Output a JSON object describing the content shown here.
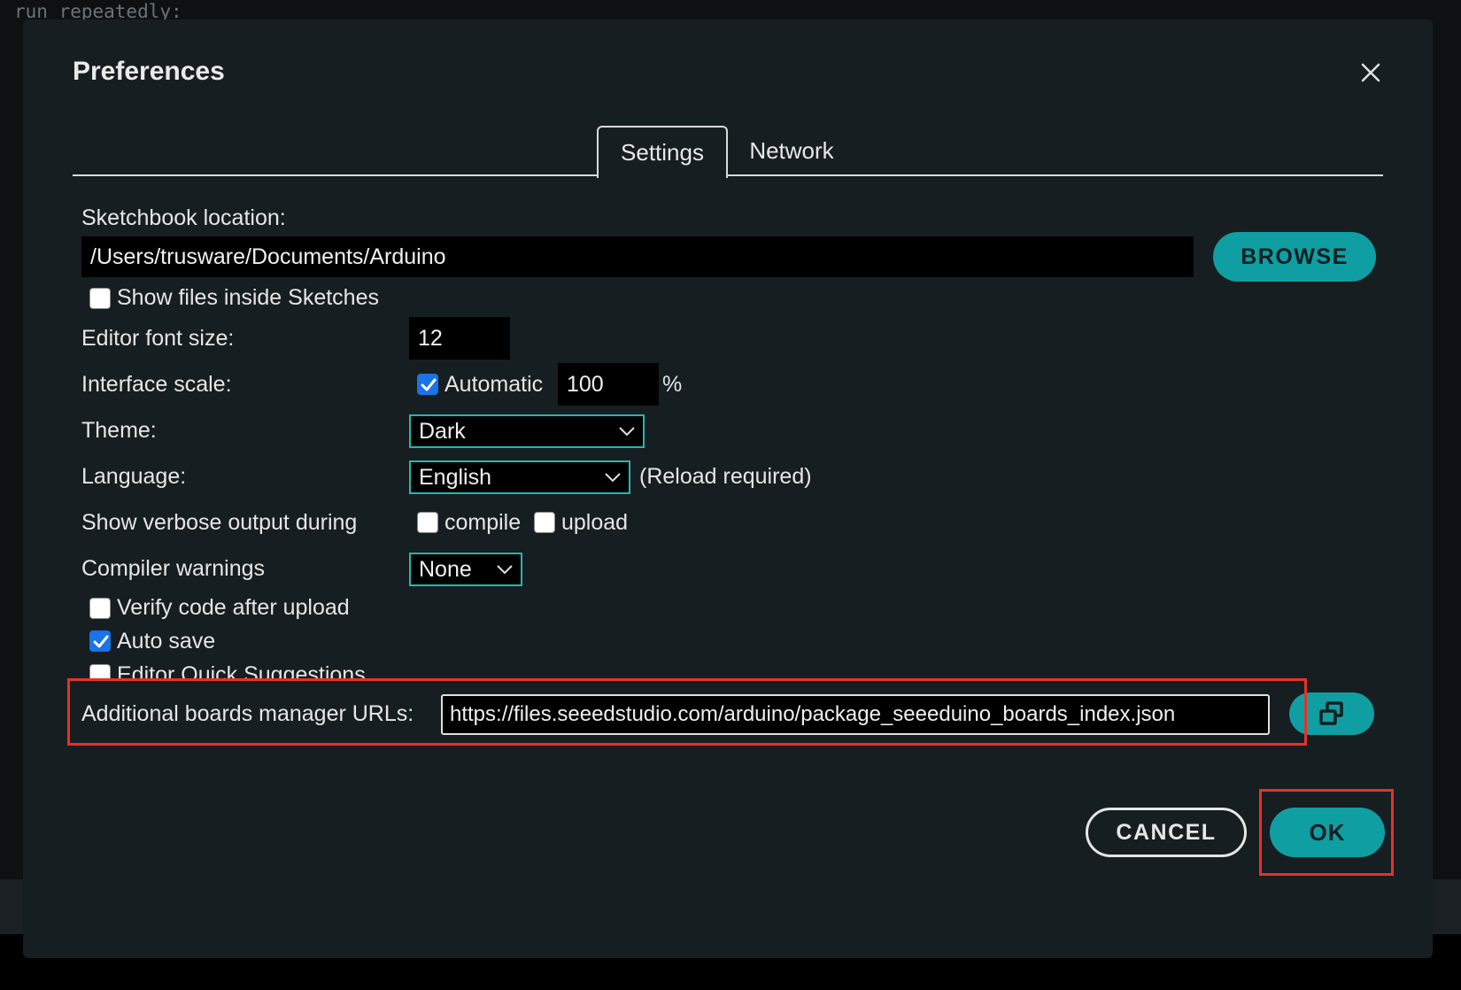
{
  "background": {
    "code_line": "run repeatedly:"
  },
  "dialog": {
    "title": "Preferences",
    "close_icon": "close-icon",
    "tabs": [
      {
        "label": "Settings",
        "active": true
      },
      {
        "label": "Network",
        "active": false
      }
    ],
    "sketchbook": {
      "label": "Sketchbook location:",
      "value": "/Users/trusware/Documents/Arduino",
      "browse_label": "BROWSE"
    },
    "show_files": {
      "label": "Show files inside Sketches",
      "checked": false
    },
    "font_size": {
      "label": "Editor font size:",
      "value": "12"
    },
    "interface_scale": {
      "label": "Interface scale:",
      "automatic_label": "Automatic",
      "automatic_checked": true,
      "value": "100",
      "unit": "%"
    },
    "theme": {
      "label": "Theme:",
      "selected": "Dark"
    },
    "language": {
      "label": "Language:",
      "selected": "English",
      "note": "(Reload required)"
    },
    "verbose": {
      "label": "Show verbose output during",
      "compile_label": "compile",
      "compile_checked": false,
      "upload_label": "upload",
      "upload_checked": false
    },
    "compiler_warnings": {
      "label": "Compiler warnings",
      "selected": "None"
    },
    "verify": {
      "label": "Verify code after upload",
      "checked": false
    },
    "auto_save": {
      "label": "Auto save",
      "checked": true
    },
    "quick_suggestions": {
      "label": "Editor Quick Suggestions",
      "checked": false
    },
    "boards_urls": {
      "label": "Additional boards manager URLs:",
      "value": "https://files.seeedstudio.com/arduino/package_seeeduino_boards_index.json",
      "expand_icon": "open-window-icon"
    },
    "buttons": {
      "cancel": "CANCEL",
      "ok": "OK"
    }
  },
  "colors": {
    "accent": "#0f9ea2",
    "highlight": "#e3322b",
    "dialog_bg": "#171e21",
    "checkbox_checked": "#1a73e8"
  }
}
